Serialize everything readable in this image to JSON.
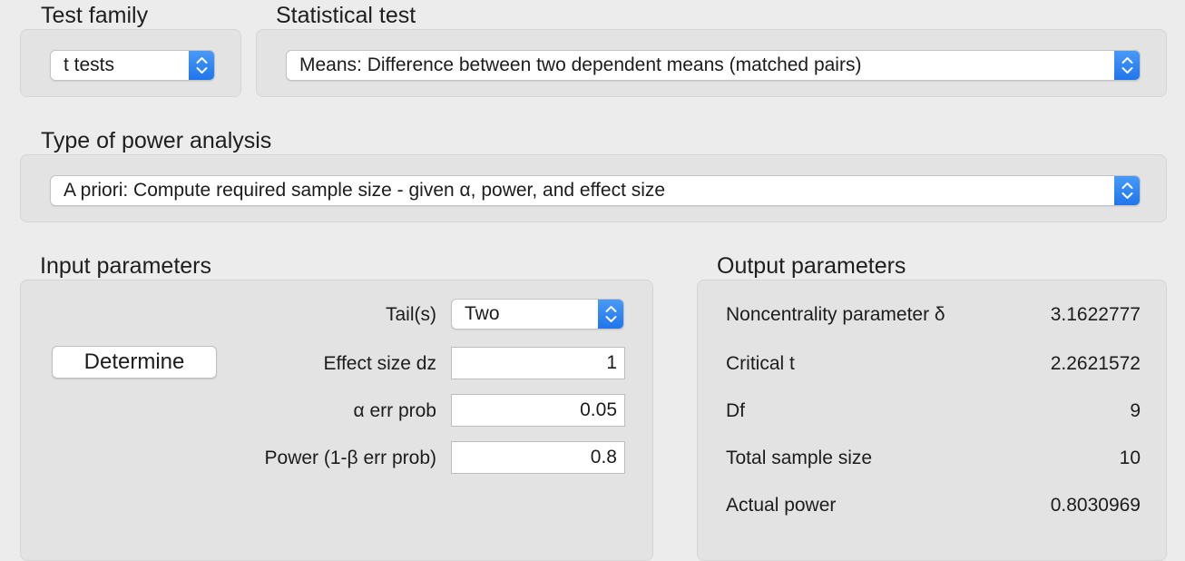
{
  "test_family": {
    "label": "Test family",
    "value": "t tests"
  },
  "statistical_test": {
    "label": "Statistical test",
    "value": "Means: Difference between two dependent means (matched pairs)"
  },
  "power_analysis": {
    "label": "Type of power analysis",
    "value": "A priori: Compute required sample size - given α, power, and effect size"
  },
  "input_parameters": {
    "label": "Input parameters",
    "determine_label": "Determine",
    "tails": {
      "label": "Tail(s)",
      "value": "Two"
    },
    "effect_size": {
      "label": "Effect size dz",
      "value": "1"
    },
    "alpha": {
      "label": "α err prob",
      "value": "0.05"
    },
    "power": {
      "label": "Power (1-β err prob)",
      "value": "0.8"
    }
  },
  "output_parameters": {
    "label": "Output parameters",
    "rows": [
      {
        "label": "Noncentrality parameter δ",
        "value": "3.1622777"
      },
      {
        "label": "Critical t",
        "value": "2.2621572"
      },
      {
        "label": "Df",
        "value": "9"
      },
      {
        "label": "Total sample size",
        "value": "10"
      },
      {
        "label": "Actual power",
        "value": "0.8030969"
      }
    ]
  },
  "colors": {
    "window_background": "#ececec",
    "group_background": "#e3e3e3",
    "stepper_accent": "#1e74ec"
  },
  "icons": {
    "popup_stepper": "chevron-up-down-icon"
  }
}
